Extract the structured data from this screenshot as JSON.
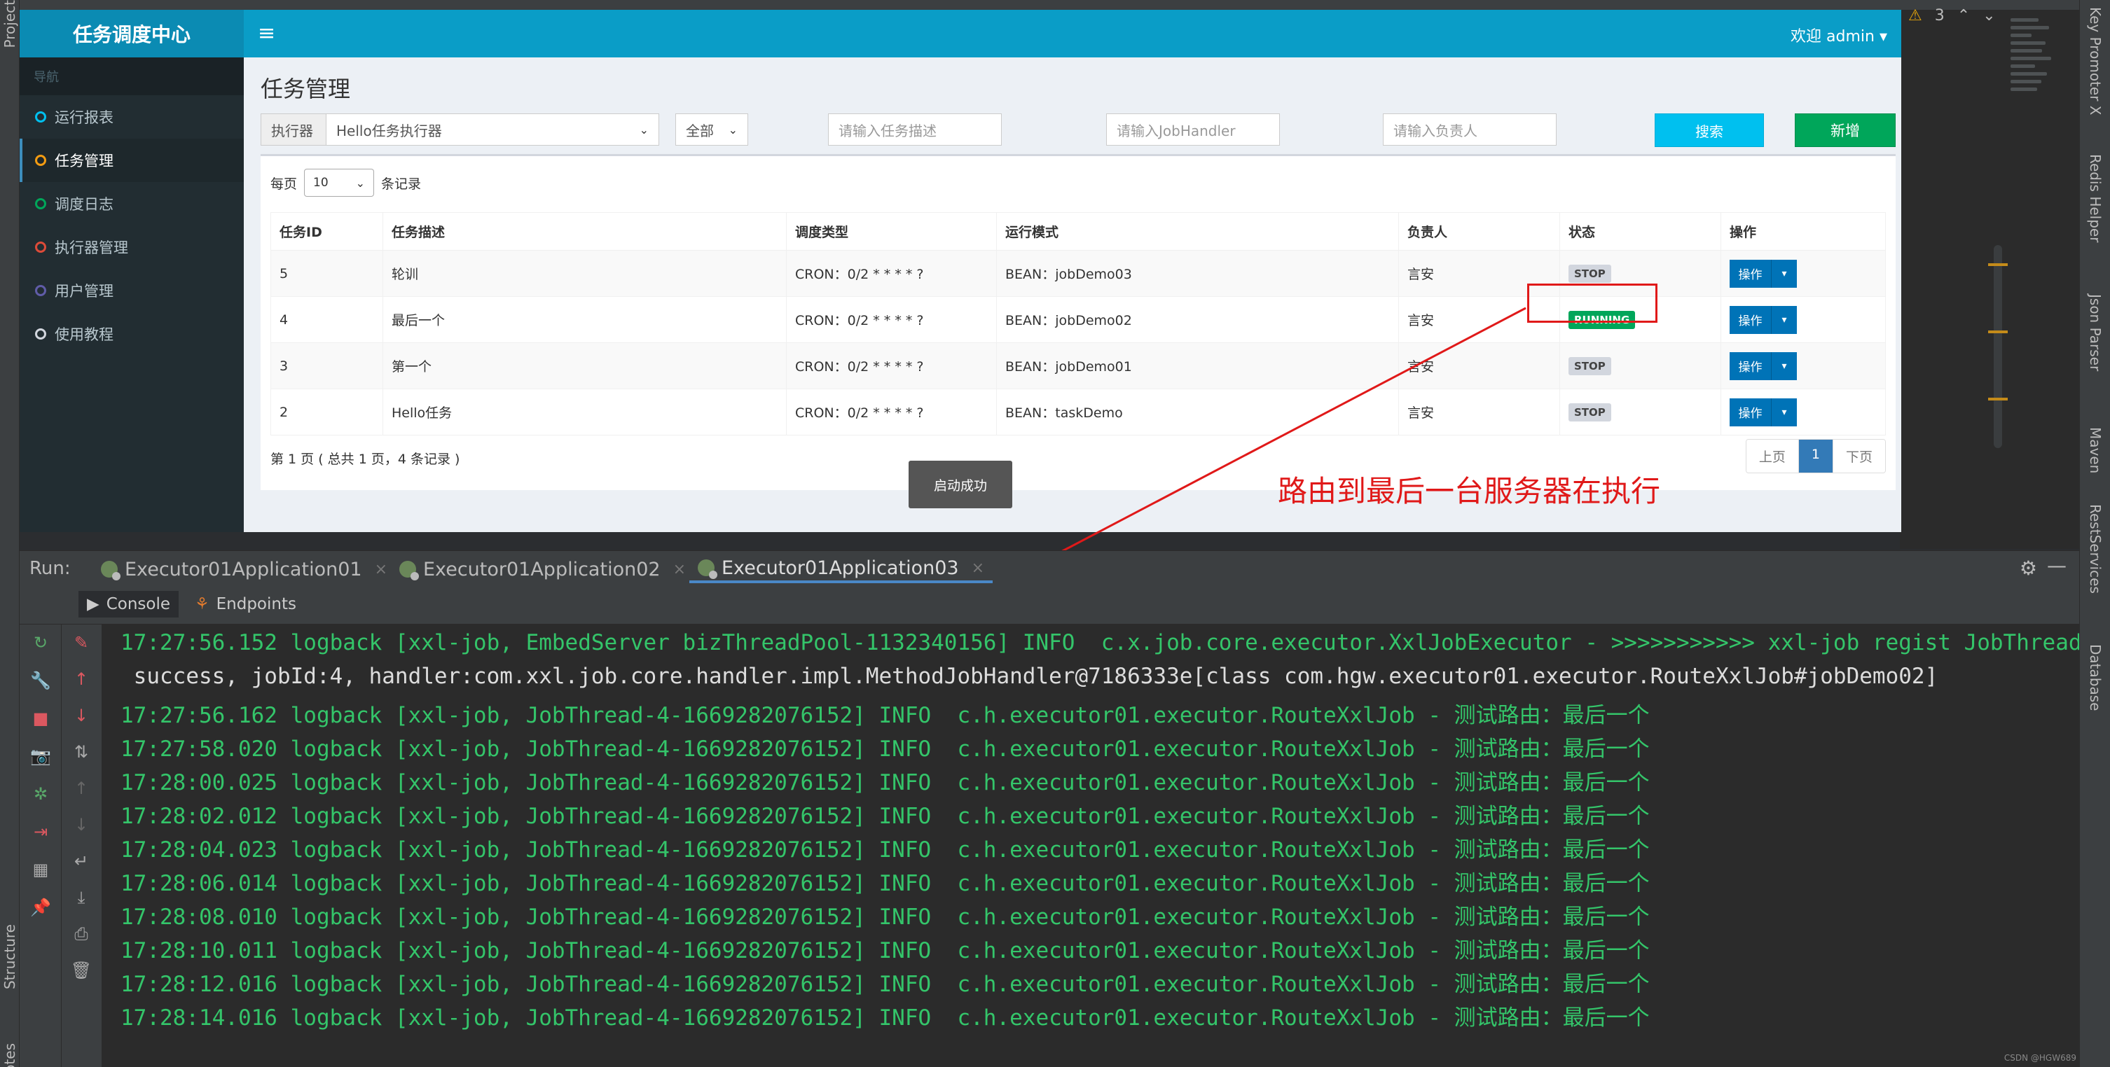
{
  "browser": {
    "logo": "任务调度中心",
    "welcome": "欢迎 admin ▾",
    "nav_header": "导航",
    "nav": [
      {
        "label": "运行报表",
        "color": "#00c0ef"
      },
      {
        "label": "任务管理",
        "color": "#f39c12"
      },
      {
        "label": "调度日志",
        "color": "#00a65a"
      },
      {
        "label": "执行器管理",
        "color": "#dd4b39"
      },
      {
        "label": "用户管理",
        "color": "#605ca8"
      },
      {
        "label": "使用教程",
        "color": "#d2d6de"
      }
    ],
    "page_title": "任务管理",
    "filters": {
      "executor_addon": "执行器",
      "executor_value": "Hello任务执行器",
      "status_value": "全部",
      "desc_placeholder": "请输入任务描述",
      "handler_placeholder": "请输入JobHandler",
      "author_placeholder": "请输入负责人",
      "search_label": "搜索",
      "add_label": "新增"
    },
    "perpage_prefix": "每页",
    "perpage_value": "10",
    "perpage_suffix": "条记录",
    "table": {
      "headers": [
        "任务ID",
        "任务描述",
        "调度类型",
        "运行模式",
        "负责人",
        "状态",
        "操作"
      ],
      "rows": [
        {
          "id": "5",
          "desc": "轮训",
          "sched": "CRON：0/2 * * * * ?",
          "mode": "BEAN：jobDemo03",
          "author": "言安",
          "status": "STOP"
        },
        {
          "id": "4",
          "desc": "最后一个",
          "sched": "CRON：0/2 * * * * ?",
          "mode": "BEAN：jobDemo02",
          "author": "言安",
          "status": "RUNNING"
        },
        {
          "id": "3",
          "desc": "第一个",
          "sched": "CRON：0/2 * * * * ?",
          "mode": "BEAN：jobDemo01",
          "author": "言安",
          "status": "STOP"
        },
        {
          "id": "2",
          "desc": "Hello任务",
          "sched": "CRON：0/2 * * * * ?",
          "mode": "BEAN：taskDemo",
          "author": "言安",
          "status": "STOP"
        }
      ],
      "op_label": "操作"
    },
    "paging_info": "第 1 页 ( 总共 1 页，4 条记录 )",
    "pager": {
      "prev": "上页",
      "current": "1",
      "next": "下页"
    },
    "toast": "启动成功"
  },
  "annotation": "路由到最后一台服务器在执行",
  "ide": {
    "warning_count": "3",
    "run_label": "Run:",
    "run_tabs": [
      "Executor01Application01",
      "Executor01Application02",
      "Executor01Application03"
    ],
    "sub_tabs": [
      "Console",
      "Endpoints"
    ],
    "side_tabs_right": [
      "Key Promoter X",
      "Redis Helper",
      "Json Parser",
      "Maven",
      "RestServices",
      "Database"
    ],
    "side_tabs_left": [
      "Project",
      "Structure",
      "Notes"
    ],
    "log_lines": [
      "17:27:56.152 logback [xxl-job, EmbedServer bizThreadPool-1132340156] INFO  c.x.job.core.executor.XxlJobExecutor - >>>>>>>>>>> xxl-job regist JobThread",
      " success, jobId:4, handler:com.xxl.job.core.handler.impl.MethodJobHandler@7186333e[class com.hgw.executor01.executor.RouteXxlJob#jobDemo02]",
      "17:27:56.162 logback [xxl-job, JobThread-4-1669282076152] INFO  c.h.executor01.executor.RouteXxlJob - 测试路由：最后一个",
      "17:27:58.020 logback [xxl-job, JobThread-4-1669282076152] INFO  c.h.executor01.executor.RouteXxlJob - 测试路由：最后一个",
      "17:28:00.025 logback [xxl-job, JobThread-4-1669282076152] INFO  c.h.executor01.executor.RouteXxlJob - 测试路由：最后一个",
      "17:28:02.012 logback [xxl-job, JobThread-4-1669282076152] INFO  c.h.executor01.executor.RouteXxlJob - 测试路由：最后一个",
      "17:28:04.023 logback [xxl-job, JobThread-4-1669282076152] INFO  c.h.executor01.executor.RouteXxlJob - 测试路由：最后一个",
      "17:28:06.014 logback [xxl-job, JobThread-4-1669282076152] INFO  c.h.executor01.executor.RouteXxlJob - 测试路由：最后一个",
      "17:28:08.010 logback [xxl-job, JobThread-4-1669282076152] INFO  c.h.executor01.executor.RouteXxlJob - 测试路由：最后一个",
      "17:28:10.011 logback [xxl-job, JobThread-4-1669282076152] INFO  c.h.executor01.executor.RouteXxlJob - 测试路由：最后一个",
      "17:28:12.016 logback [xxl-job, JobThread-4-1669282076152] INFO  c.h.executor01.executor.RouteXxlJob - 测试路由：最后一个",
      "17:28:14.016 logback [xxl-job, JobThread-4-1669282076152] INFO  c.h.executor01.executor.RouteXxlJob - 测试路由：最后一个"
    ],
    "watermark": "CSDN @HGW689"
  }
}
